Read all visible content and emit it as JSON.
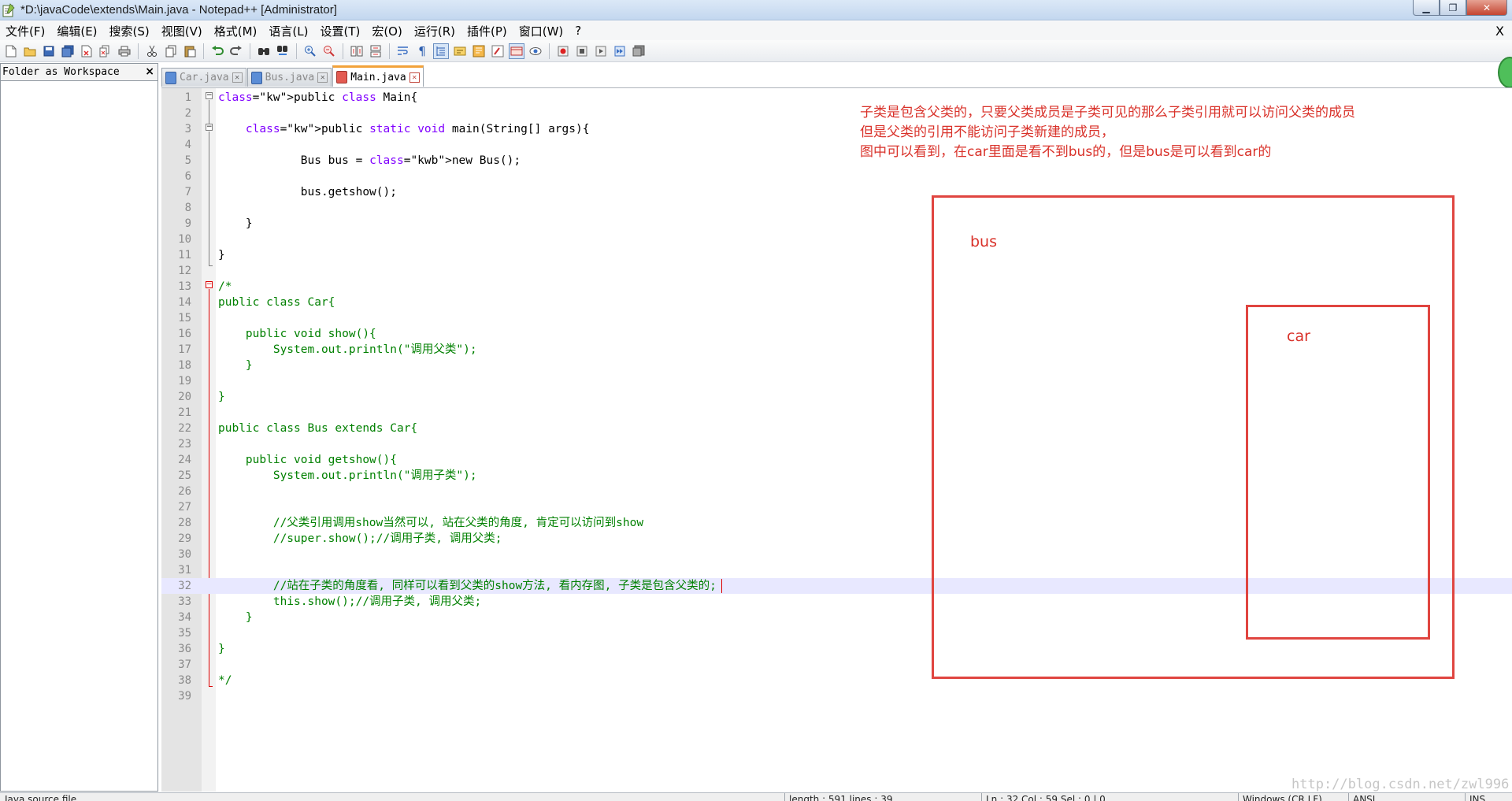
{
  "window": {
    "title": "*D:\\javaCode\\extends\\Main.java - Notepad++ [Administrator]",
    "close_glyph": "X"
  },
  "menu": [
    "文件(F)",
    "编辑(E)",
    "搜索(S)",
    "视图(V)",
    "格式(M)",
    "语言(L)",
    "设置(T)",
    "宏(O)",
    "运行(R)",
    "插件(P)",
    "窗口(W)",
    "?"
  ],
  "panel": {
    "title": "Folder as Workspace",
    "close_glyph": "×"
  },
  "tabs": [
    {
      "label": "Car.java",
      "active": false
    },
    {
      "label": "Bus.java",
      "active": false
    },
    {
      "label": "Main.java",
      "active": true
    }
  ],
  "editor": {
    "current_line": 32,
    "lines": [
      {
        "n": "1",
        "text": "public class Main{"
      },
      {
        "n": "2",
        "text": ""
      },
      {
        "n": "3",
        "text": "    public static void main(String[] args){"
      },
      {
        "n": "4",
        "text": ""
      },
      {
        "n": "5",
        "text": "            Bus bus = new Bus();"
      },
      {
        "n": "6",
        "text": ""
      },
      {
        "n": "7",
        "text": "            bus.getshow();"
      },
      {
        "n": "8",
        "text": ""
      },
      {
        "n": "9",
        "text": "    }"
      },
      {
        "n": "10",
        "text": ""
      },
      {
        "n": "11",
        "text": "}"
      },
      {
        "n": "12",
        "text": ""
      },
      {
        "n": "13",
        "text": "/*"
      },
      {
        "n": "14",
        "text": "public class Car{"
      },
      {
        "n": "15",
        "text": ""
      },
      {
        "n": "16",
        "text": "    public void show(){"
      },
      {
        "n": "17",
        "text": "        System.out.println(\"调用父类\");"
      },
      {
        "n": "18",
        "text": "    }"
      },
      {
        "n": "19",
        "text": ""
      },
      {
        "n": "20",
        "text": "}"
      },
      {
        "n": "21",
        "text": ""
      },
      {
        "n": "22",
        "text": "public class Bus extends Car{"
      },
      {
        "n": "23",
        "text": ""
      },
      {
        "n": "24",
        "text": "    public void getshow(){"
      },
      {
        "n": "25",
        "text": "        System.out.println(\"调用子类\");"
      },
      {
        "n": "26",
        "text": ""
      },
      {
        "n": "27",
        "text": ""
      },
      {
        "n": "28",
        "text": "        //父类引用调用show当然可以, 站在父类的角度, 肯定可以访问到show"
      },
      {
        "n": "29",
        "text": "        //super.show();//调用子类, 调用父类;"
      },
      {
        "n": "30",
        "text": ""
      },
      {
        "n": "31",
        "text": ""
      },
      {
        "n": "32",
        "text": "        //站在子类的角度看, 同样可以看到父类的show方法, 看内存图, 子类是包含父类的;"
      },
      {
        "n": "33",
        "text": "        this.show();//调用子类, 调用父类;"
      },
      {
        "n": "34",
        "text": "    }"
      },
      {
        "n": "35",
        "text": ""
      },
      {
        "n": "36",
        "text": "}"
      },
      {
        "n": "37",
        "text": ""
      },
      {
        "n": "38",
        "text": "*/"
      },
      {
        "n": "39",
        "text": ""
      }
    ]
  },
  "annotation": {
    "line1": "子类是包含父类的，只要父类成员是子类可见的那么子类引用就可以访问父类的成员",
    "line2": "但是父类的引用不能访问子类新建的成员，",
    "line3": "图中可以看到，在car里面是看不到bus的，但是bus是可以看到car的",
    "bus_label": "bus",
    "car_label": "car",
    "color": "#d9322a"
  },
  "watermark": "http://blog.csdn.net/zwl996",
  "statusbar": {
    "file_type": "Java source file",
    "length": "length : 591   lines : 39",
    "position": "Ln : 32   Col : 59   Sel : 0 | 0",
    "eol": "Windows (CR LF)",
    "encoding": "ANSI",
    "mode": "INS"
  },
  "colors": {
    "keyword": "#8000ff",
    "keyword_bold": "#0000ff",
    "comment": "#008000",
    "current_line": "#e8e8ff"
  }
}
